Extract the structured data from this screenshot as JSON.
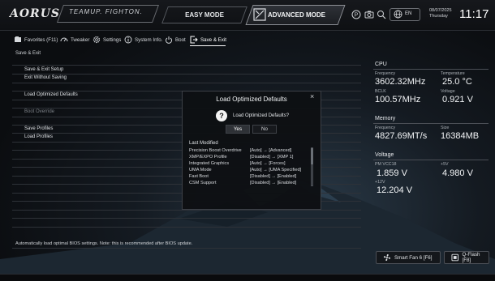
{
  "header": {
    "logo": "AORUS",
    "partner_logo": "TEAMUP. FIGHTON.",
    "easy_mode": "EASY MODE",
    "advanced_mode": "ADVANCED MODE",
    "language": "EN",
    "date": "08/07/2025",
    "weekday": "Thursday",
    "time": "11:17"
  },
  "menu": {
    "favorites": "Favorites (F11)",
    "tweaker": "Tweaker",
    "settings": "Settings",
    "system_info": "System Info.",
    "boot": "Boot",
    "save_exit": "Save & Exit"
  },
  "breadcrumb": "Save & Exit",
  "list": {
    "save_exit_setup": "Save & Exit Setup",
    "exit_without_saving": "Exit Without Saving",
    "load_optimized_defaults": "Load Optimized Defaults",
    "boot_override": "Boot Override",
    "save_profiles": "Save Profiles",
    "load_profiles": "Load Profiles"
  },
  "panel": {
    "cpu": {
      "title": "CPU",
      "frequency_label": "Frequency",
      "frequency": "3602.32MHz",
      "temperature_label": "Temperature",
      "temperature": "25.0 °C",
      "bclk_label": "BCLK",
      "bclk": "100.57MHz",
      "voltage_label": "Voltage",
      "voltage": "0.921 V"
    },
    "memory": {
      "title": "Memory",
      "frequency_label": "Frequency",
      "frequency": "4827.69MT/s",
      "size_label": "Size",
      "size": "16384MB"
    },
    "voltage": {
      "title": "Voltage",
      "pm_label": "PM VCC18",
      "pm": "1.859 V",
      "v5_label": "+5V",
      "v5": "4.980 V",
      "v12_label": "+12V",
      "v12": "12.204 V"
    }
  },
  "dialog": {
    "title": "Load Optimized Defaults",
    "close": "×",
    "question": "Load Optimized Defaults?",
    "yes": "Yes",
    "no": "No",
    "last_modified": "Last Modified",
    "changes": [
      {
        "name": "Precision Boost Overdrive",
        "value": "[Auto] → [Advanced]"
      },
      {
        "name": "XMP/EXPO Profile",
        "value": "[Disabled] → [XMP 1]"
      },
      {
        "name": "Integrated Graphics",
        "value": "[Auto] → [Forces]"
      },
      {
        "name": "UMA Mode",
        "value": "[Auto] → [UMA Specified]"
      },
      {
        "name": "Fast Boot",
        "value": "[Disabled] → [Enabled]"
      },
      {
        "name": "CSM Support",
        "value": "[Disabled] → [Enabled]"
      }
    ]
  },
  "footer": {
    "hint": "Automatically load optimal BIOS settings. Note: this is recommended after BIOS update.",
    "smart_fan": "Smart Fan 6 [F6]",
    "qflash": "Q-Flash [F8]"
  },
  "colors": {
    "accent": "#ffffff",
    "panel_border": "#4a4e55"
  }
}
